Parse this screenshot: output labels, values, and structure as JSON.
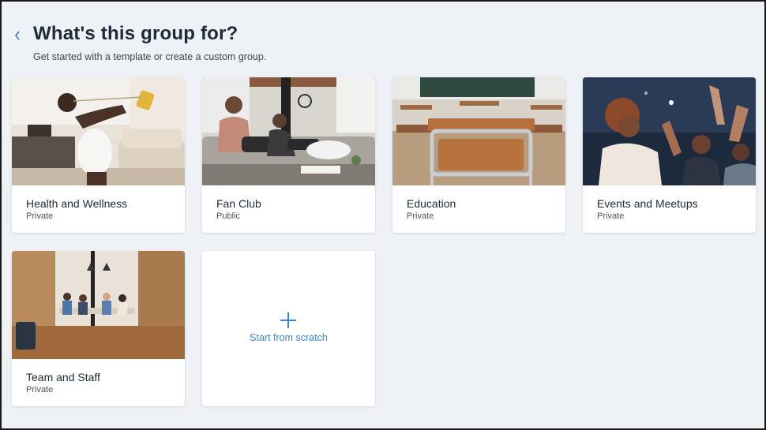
{
  "header": {
    "title": "What's this group for?",
    "subtitle": "Get started with a template or create a custom group."
  },
  "templates": [
    {
      "name": "Health and Wellness",
      "privacy": "Private",
      "image": "woman-exercising-with-resistance-band"
    },
    {
      "name": "Fan Club",
      "privacy": "Public",
      "image": "friends-gaming-on-couch"
    },
    {
      "name": "Education",
      "privacy": "Private",
      "image": "empty-classroom-chairs"
    },
    {
      "name": "Events and Meetups",
      "privacy": "Private",
      "image": "cheering-concert-crowd"
    },
    {
      "name": "Team and Staff",
      "privacy": "Private",
      "image": "office-meeting-room"
    }
  ],
  "scratch": {
    "label": "Start from scratch",
    "icon": "plus-icon"
  },
  "colors": {
    "accent": "#3a89d0",
    "background": "#eef1f5",
    "title": "#1c2a3a"
  }
}
